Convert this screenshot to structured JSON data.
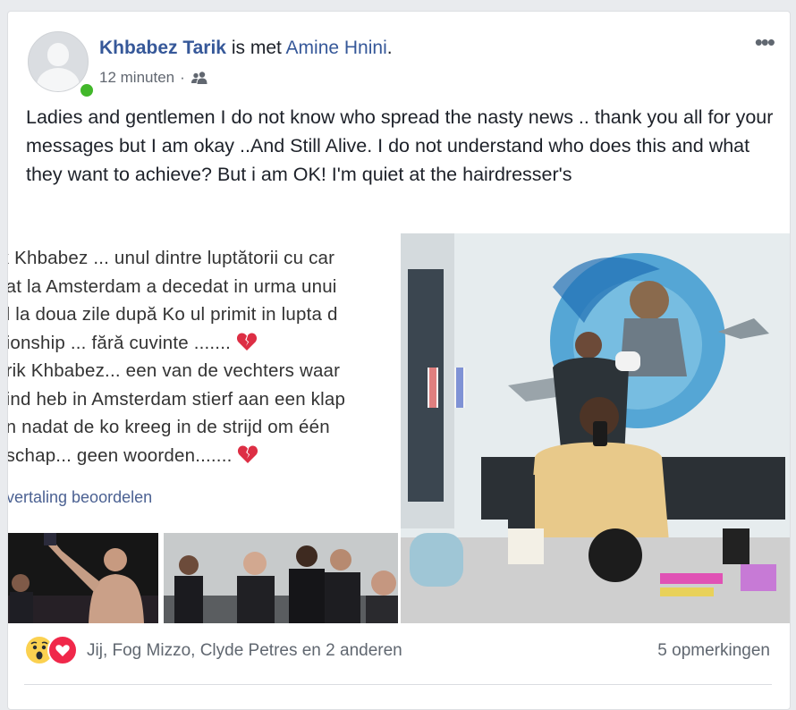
{
  "post": {
    "author_name": "Khbabez Tarik",
    "with_text": "is met",
    "tagged_name": "Amine Hnini",
    "title_end": ".",
    "time": "12 minuten",
    "separator": "·",
    "audience_icon": "friends-icon",
    "more_icon": "•••",
    "text": "Ladies and gentlemen I do not know who spread the nasty news .. thank you all for your messages but I am okay ..And Still Alive. I do not understand who does this and what they want to achieve? But i am OK! I'm quiet at the hairdresser's"
  },
  "photo1": {
    "lines": [
      "ik Khbabez ... unul dintre luptătorii cu car",
      "nat la Amsterdam a decedat in urma unui",
      "al la doua zile după Ko ul primit in lupta d",
      "pionship ... fără cuvinte ....... ",
      "arik Khbabez... een van de vechters waar",
      "aind heb in Amsterdam stierf aan een klap",
      "en nadat de ko kreeg in de strijd om één",
      "nschap... geen woorden....... "
    ],
    "translate_link": "vertaling beoordelen"
  },
  "footer": {
    "reactions": [
      "wow",
      "love"
    ],
    "reactors": "Jij, Fog Mizzo, Clyde Petres en 2 anderen",
    "comments": "5 opmerkingen"
  },
  "colors": {
    "link": "#365899",
    "secondary_text": "#616770",
    "online": "#42b72a",
    "love": "#f0284a",
    "wow": "#fbd150"
  }
}
